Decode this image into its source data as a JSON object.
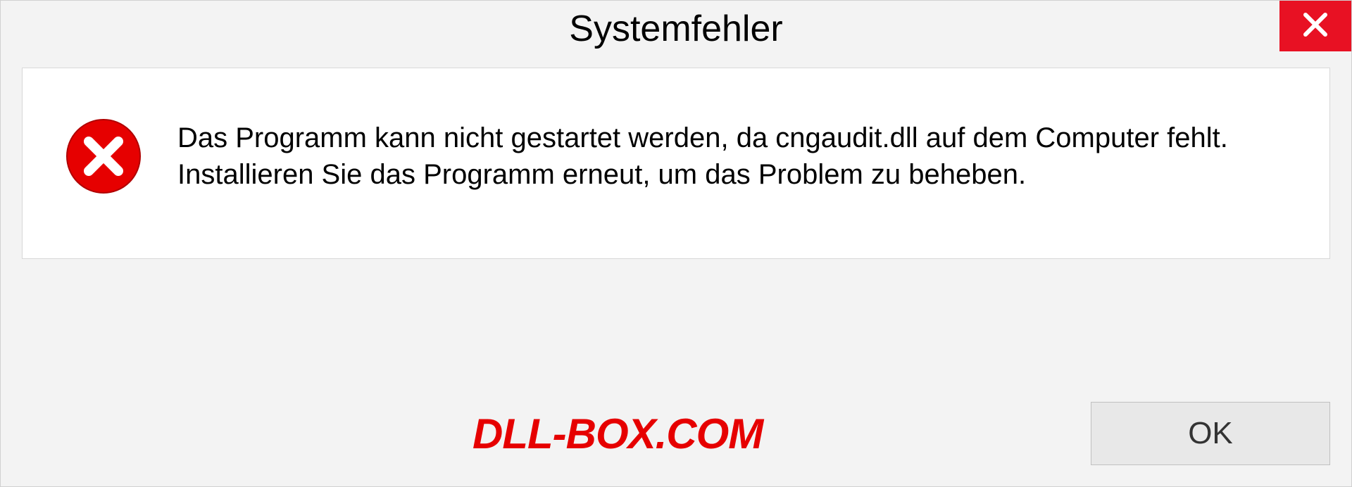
{
  "dialog": {
    "title": "Systemfehler",
    "message": "Das Programm kann nicht gestartet werden, da cngaudit.dll auf dem Computer fehlt. Installieren Sie das Programm erneut, um das Problem zu beheben.",
    "ok_label": "OK"
  },
  "watermark": "DLL-BOX.COM",
  "colors": {
    "close_bg": "#e81123",
    "error_icon": "#e60000",
    "watermark": "#e60000"
  }
}
